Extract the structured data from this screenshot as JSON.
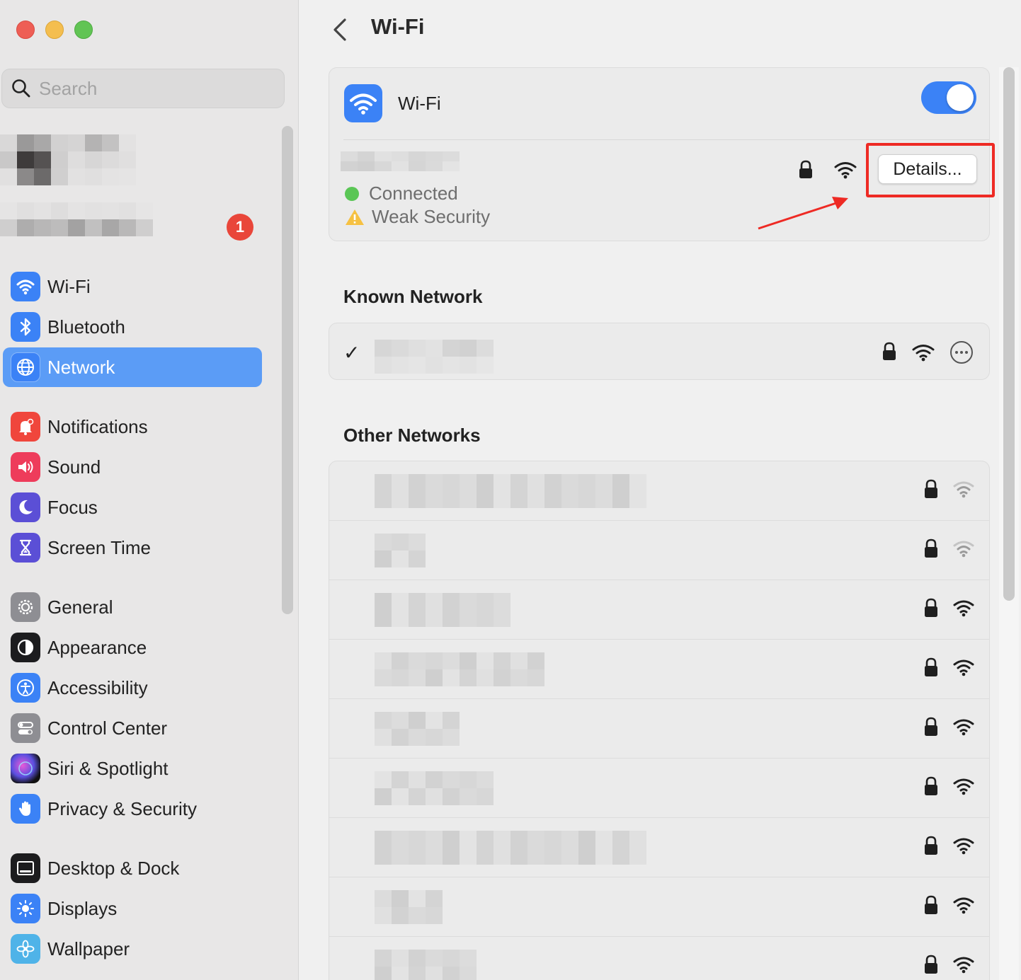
{
  "window": {
    "title": "Wi-Fi"
  },
  "sidebar": {
    "search_placeholder": "Search",
    "notification_badge": "1",
    "items": [
      {
        "label": "Wi-Fi",
        "icon": "wifi-icon",
        "color": "#3b82f6",
        "active": false
      },
      {
        "label": "Bluetooth",
        "icon": "bluetooth-icon",
        "color": "#3b82f6",
        "active": false
      },
      {
        "label": "Network",
        "icon": "globe-icon",
        "color": "#3b82f6",
        "active": true
      },
      {
        "label": "Notifications",
        "icon": "bell-icon",
        "color": "#f0463c",
        "active": false
      },
      {
        "label": "Sound",
        "icon": "speaker-icon",
        "color": "#ee3c5b",
        "active": false
      },
      {
        "label": "Focus",
        "icon": "moon-icon",
        "color": "#5b4fd6",
        "active": false
      },
      {
        "label": "Screen Time",
        "icon": "hourglass-icon",
        "color": "#5b4fd6",
        "active": false
      },
      {
        "label": "General",
        "icon": "gear-icon",
        "color": "#8e8e93",
        "active": false
      },
      {
        "label": "Appearance",
        "icon": "appearance-icon",
        "color": "#1c1c1e",
        "active": false
      },
      {
        "label": "Accessibility",
        "icon": "accessibility-icon",
        "color": "#3b82f6",
        "active": false
      },
      {
        "label": "Control Center",
        "icon": "toggles-icon",
        "color": "#8e8e93",
        "active": false
      },
      {
        "label": "Siri & Spotlight",
        "icon": "siri-icon",
        "color": "#7a2fd0",
        "active": false
      },
      {
        "label": "Privacy & Security",
        "icon": "hand-icon",
        "color": "#3b82f6",
        "active": false
      },
      {
        "label": "Desktop & Dock",
        "icon": "dock-icon",
        "color": "#1c1c1e",
        "active": false
      },
      {
        "label": "Displays",
        "icon": "sun-icon",
        "color": "#3b82f6",
        "active": false
      },
      {
        "label": "Wallpaper",
        "icon": "flower-icon",
        "color": "#4fb3e8",
        "active": false
      }
    ]
  },
  "main": {
    "title": "Wi-Fi",
    "wifi_toggle": {
      "label": "Wi-Fi",
      "on": true
    },
    "current_network": {
      "status": "Connected",
      "security_warning": "Weak Security",
      "details_button": "Details..."
    },
    "known_network_heading": "Known Network",
    "other_networks_heading": "Other Networks",
    "other_networks_count_visible": 9
  },
  "colors": {
    "accent": "#3b82f6",
    "sidebar_selected": "#5b9cf6",
    "annotation_red": "#ee2a24",
    "connected_green": "#5ac655",
    "warning_yellow": "#f6c142"
  }
}
